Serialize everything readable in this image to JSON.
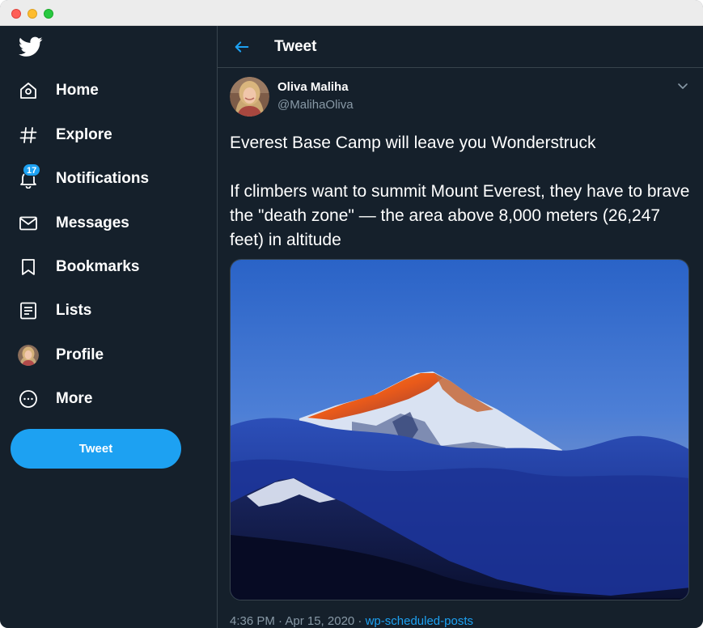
{
  "window": {
    "controls": [
      "close",
      "minimize",
      "maximize"
    ]
  },
  "sidebar": {
    "logo_icon": "twitter-bird-icon",
    "items": [
      {
        "label": "Home",
        "icon": "home-icon"
      },
      {
        "label": "Explore",
        "icon": "hashtag-icon"
      },
      {
        "label": "Notifications",
        "icon": "bell-icon",
        "badge": "17"
      },
      {
        "label": "Messages",
        "icon": "envelope-icon"
      },
      {
        "label": "Bookmarks",
        "icon": "bookmark-icon"
      },
      {
        "label": "Lists",
        "icon": "list-icon"
      },
      {
        "label": "Profile",
        "icon": "avatar"
      },
      {
        "label": "More",
        "icon": "more-circle-icon"
      }
    ],
    "tweet_button": "Tweet"
  },
  "header": {
    "title": "Tweet",
    "back_icon": "back-arrow-icon"
  },
  "tweet": {
    "author_name": "Oliva Maliha",
    "author_handle": "@MalihaOliva",
    "text": "Everest Base Camp will leave you Wonderstruck\n\nIf climbers want to summit Mount Everest, they have to brave the \"death zone\" — the area above 8,000 meters (26,247 feet) in altitude",
    "time": "4:36 PM · Apr 15, 2020 · ",
    "source": "wp-scheduled-posts"
  },
  "colors": {
    "background": "#15202b",
    "accent": "#1da1f2",
    "secondary_text": "#8899a6",
    "border": "#38444d"
  }
}
